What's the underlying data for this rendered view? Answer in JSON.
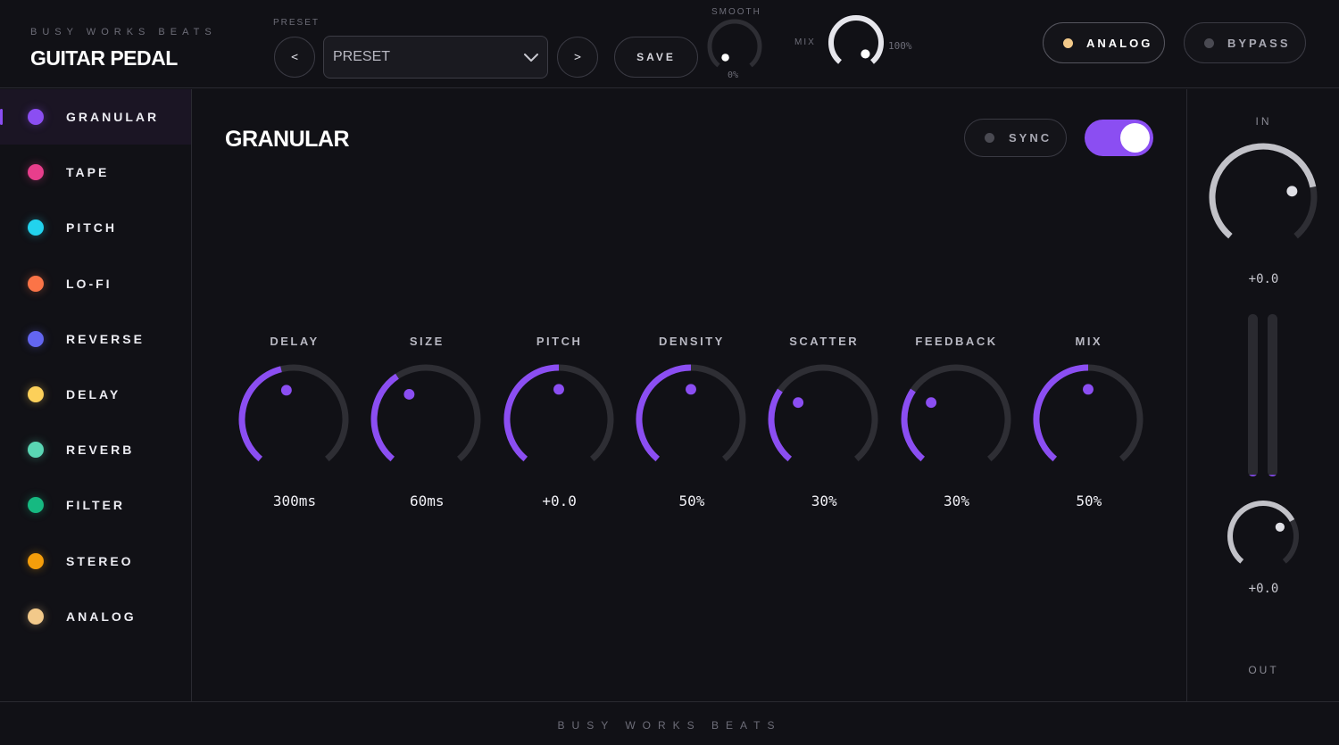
{
  "header": {
    "brand": "BUSY WORKS BEATS",
    "title": "GUITAR PEDAL",
    "preset_label": "PRESET",
    "preset_value": "PRESET",
    "prev_label": "<",
    "next_label": ">",
    "save_label": "SAVE",
    "smooth_label": "SMOOTH",
    "smooth_value": "0%",
    "smooth_level": 0.0,
    "mix_label": "MIX",
    "mix_value": "100%",
    "mix_level": 1.0,
    "analog_label": "ANALOG",
    "bypass_label": "BYPASS"
  },
  "sidebar": {
    "items": [
      {
        "label": "GRANULAR",
        "color": "#8b4ef2",
        "active": true
      },
      {
        "label": "TAPE",
        "color": "#e83e8c",
        "active": false
      },
      {
        "label": "PITCH",
        "color": "#22d3ee",
        "active": false
      },
      {
        "label": "LO-FI",
        "color": "#fb7447",
        "active": false
      },
      {
        "label": "REVERSE",
        "color": "#6366f1",
        "active": false
      },
      {
        "label": "DELAY",
        "color": "#fcd05a",
        "active": false
      },
      {
        "label": "REVERB",
        "color": "#5ad6b4",
        "active": false
      },
      {
        "label": "FILTER",
        "color": "#16b981",
        "active": false
      },
      {
        "label": "STEREO",
        "color": "#f59e0b",
        "active": false
      },
      {
        "label": "ANALOG",
        "color": "#f2c98a",
        "active": false
      }
    ]
  },
  "main": {
    "title": "GRANULAR",
    "sync_label": "SYNC",
    "power_on": true,
    "knobs": [
      {
        "label": "DELAY",
        "value": "300ms",
        "level": 0.45
      },
      {
        "label": "SIZE",
        "value": "60ms",
        "level": 0.38
      },
      {
        "label": "PITCH",
        "value": "+0.0",
        "level": 0.5
      },
      {
        "label": "DENSITY",
        "value": "50%",
        "level": 0.5
      },
      {
        "label": "SCATTER",
        "value": "30%",
        "level": 0.3
      },
      {
        "label": "FEEDBACK",
        "value": "30%",
        "level": 0.3
      },
      {
        "label": "MIX",
        "value": "50%",
        "level": 0.5
      }
    ]
  },
  "meter": {
    "in_label": "IN",
    "in_value": "+0.0",
    "in_level": 0.78,
    "out_value": "+0.0",
    "out_level": 0.72,
    "out_label": "OUT",
    "meter_left_level": 0.01,
    "meter_right_level": 0.01
  },
  "footer": {
    "brand": "BUSY WORKS BEATS"
  },
  "colors": {
    "accent": "#8b4ef2",
    "track": "#2e2e34",
    "bg": "#111116"
  }
}
